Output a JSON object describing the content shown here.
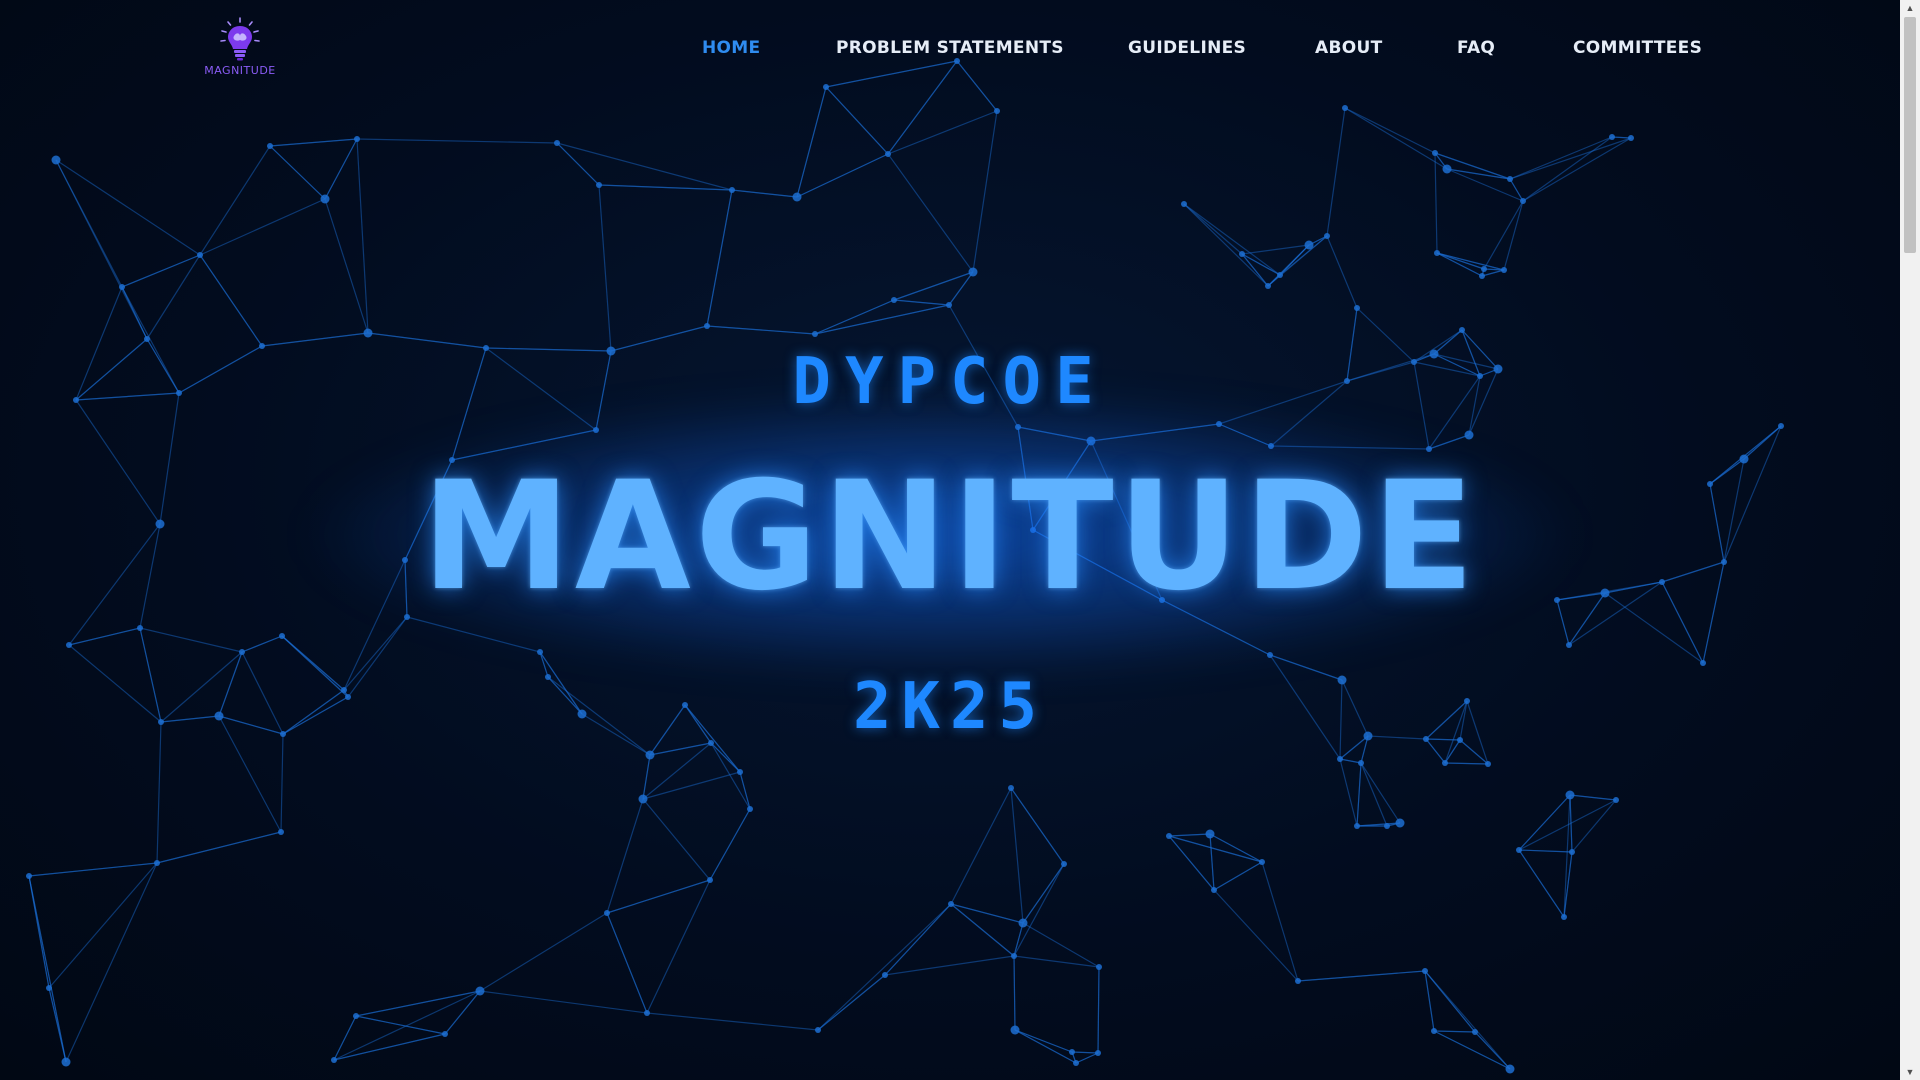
{
  "logo": {
    "text": "MAGNITUDE",
    "icon": "lightbulb-brain-icon",
    "color": "#8b5cf6"
  },
  "nav": {
    "items": [
      {
        "label": "HOME",
        "active": true
      },
      {
        "label": "PROBLEM STATEMENTS",
        "active": false
      },
      {
        "label": "GUIDELINES",
        "active": false
      },
      {
        "label": "ABOUT",
        "active": false
      },
      {
        "label": "FAQ",
        "active": false
      },
      {
        "label": "COMMITTEES",
        "active": false
      }
    ],
    "active_color": "#2f8cf0",
    "text_color": "#e6edf7"
  },
  "hero": {
    "top_line": "DYPCOE",
    "title": "MAGNITUDE",
    "subtitle": "2K25",
    "accent_color": "#1e88ff",
    "title_color": "#5fb2ff"
  },
  "background": {
    "color": "#020c1f",
    "line_color": "#1a6fd6",
    "node_color": "#1d6fd1"
  }
}
